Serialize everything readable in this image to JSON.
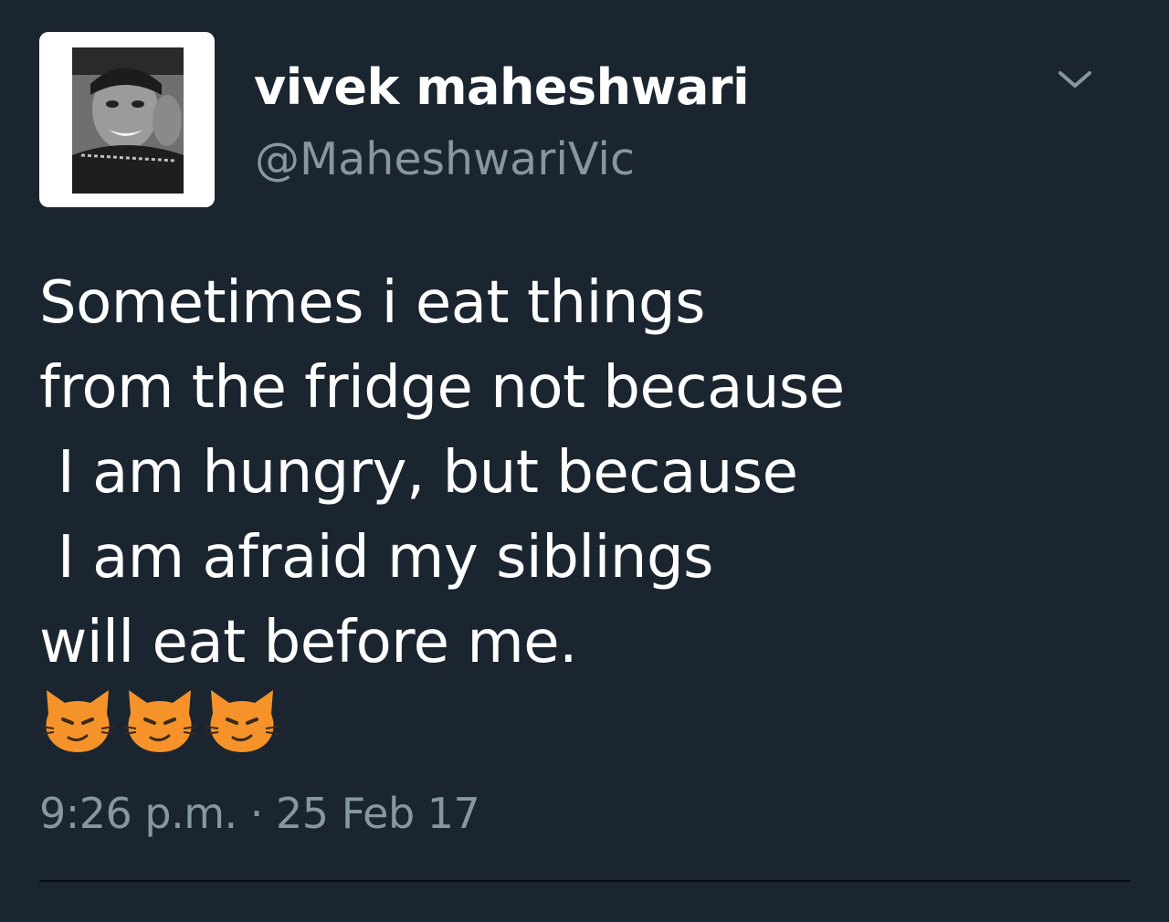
{
  "tweet": {
    "author": {
      "display_name": "vivek maheshwari",
      "handle": "@MaheshwariVic",
      "avatar_icon": "user-photo-avatar"
    },
    "menu_icon": "chevron-down-icon",
    "text_lines": [
      "Sometimes i eat things",
      "from the fridge not because",
      " I am hungry, but because",
      " I am afraid my siblings",
      "will eat before me."
    ],
    "emojis": [
      "smirking-cat-face",
      "smirking-cat-face",
      "smirking-cat-face"
    ],
    "timestamp": "9:26 p.m. · 25 Feb 17"
  },
  "colors": {
    "background": "#1a2530",
    "text_primary": "#ffffff",
    "text_secondary": "#8796a3",
    "emoji_orange": "#f5932a"
  }
}
